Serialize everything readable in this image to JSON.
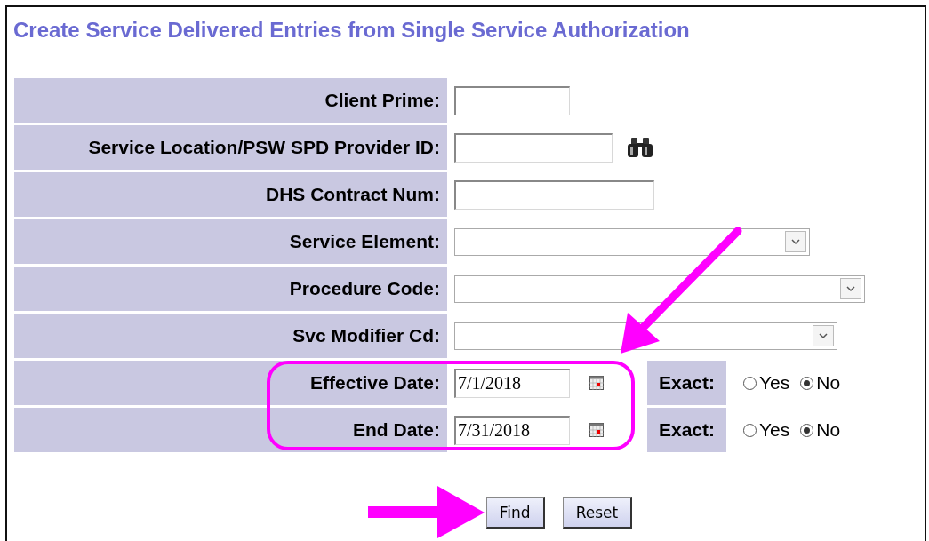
{
  "title": "Create Service Delivered Entries from Single Service Authorization",
  "fields": [
    {
      "kind": "text",
      "label": "Client Prime:"
    },
    {
      "kind": "lookup",
      "label": "Service Location/PSW SPD Provider ID:"
    },
    {
      "kind": "text",
      "label": "DHS Contract Num:"
    },
    {
      "kind": "select",
      "label": "Service Element:"
    },
    {
      "kind": "select",
      "label": "Procedure Code:"
    },
    {
      "kind": "select",
      "label": "Svc Modifier Cd:"
    },
    {
      "kind": "date",
      "label": "Effective Date:",
      "value": "7/1/2018",
      "exact": {
        "label": "Exact:",
        "options": [
          {
            "label": "Yes",
            "selected": false
          },
          {
            "label": "No",
            "selected": true
          }
        ]
      }
    },
    {
      "kind": "date",
      "label": "End Date:",
      "value": "7/31/2018",
      "exact": {
        "label": "Exact:",
        "options": [
          {
            "label": "Yes",
            "selected": false
          },
          {
            "label": "No",
            "selected": true
          }
        ]
      }
    }
  ],
  "buttons": [
    {
      "label": "Find"
    },
    {
      "label": "Reset"
    }
  ]
}
